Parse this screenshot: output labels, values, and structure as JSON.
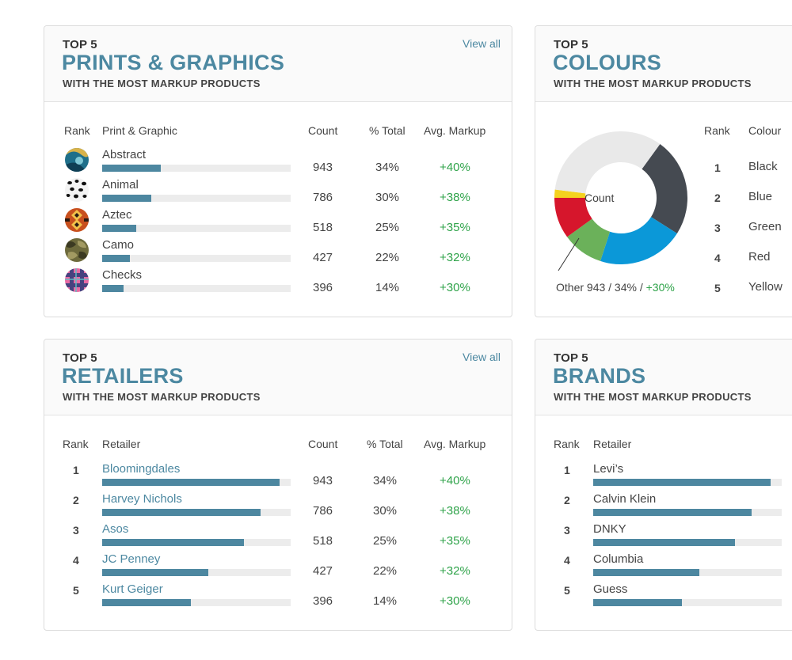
{
  "prints": {
    "top": "TOP 5",
    "title": "PRINTS & GRAPHICS",
    "subtitle": "WITH THE MOST MARKUP PRODUCTS",
    "view_all": "View all",
    "columns": {
      "rank": "Rank",
      "item": "Print & Graphic",
      "count": "Count",
      "total": "% Total",
      "markup": "Avg. Markup"
    },
    "rows": [
      {
        "name": "Abstract",
        "count": "943",
        "total": "34%",
        "markup": "+40%",
        "bar": 0.31,
        "swatch": "abstract-swatch-icon"
      },
      {
        "name": "Animal",
        "count": "786",
        "total": "30%",
        "markup": "+38%",
        "bar": 0.26,
        "swatch": "animal-swatch-icon"
      },
      {
        "name": "Aztec",
        "count": "518",
        "total": "25%",
        "markup": "+35%",
        "bar": 0.18,
        "swatch": "aztec-swatch-icon"
      },
      {
        "name": "Camo",
        "count": "427",
        "total": "22%",
        "markup": "+32%",
        "bar": 0.147,
        "swatch": "camo-swatch-icon"
      },
      {
        "name": "Checks",
        "count": "396",
        "total": "14%",
        "markup": "+30%",
        "bar": 0.115,
        "swatch": "checks-swatch-icon"
      }
    ]
  },
  "colours": {
    "top": "TOP 5",
    "title": "COLOURS",
    "subtitle": "WITH THE MOST MARKUP PRODUCTS",
    "center_label": "Count",
    "other_label": "Other 943 / 34% / ",
    "other_markup": "+30%",
    "columns": {
      "rank": "Rank",
      "item": "Colour"
    },
    "rows": [
      {
        "rank": "1",
        "name": "Black"
      },
      {
        "rank": "2",
        "name": "Blue"
      },
      {
        "rank": "3",
        "name": "Green"
      },
      {
        "rank": "4",
        "name": "Red"
      },
      {
        "rank": "5",
        "name": "Yellow"
      }
    ],
    "segments": [
      {
        "name": "Black",
        "value": 24,
        "color": "#454a51"
      },
      {
        "name": "Blue",
        "value": 21,
        "color": "#0b98d8"
      },
      {
        "name": "Green",
        "value": 10,
        "color": "#6bb15a"
      },
      {
        "name": "Red",
        "value": 10,
        "color": "#d6162c"
      },
      {
        "name": "Yellow",
        "value": 2,
        "color": "#f4d21f"
      },
      {
        "name": "Other",
        "value": 33,
        "color": "#e9e9e9"
      }
    ]
  },
  "retailers": {
    "top": "TOP 5",
    "title": "RETAILERS",
    "subtitle": "WITH THE MOST MARKUP PRODUCTS",
    "view_all": "View all",
    "columns": {
      "rank": "Rank",
      "item": "Retailer",
      "count": "Count",
      "total": "% Total",
      "markup": "Avg. Markup"
    },
    "rows": [
      {
        "rank": "1",
        "name": "Bloomingdales",
        "count": "943",
        "total": "34%",
        "markup": "+40%",
        "bar": 0.94
      },
      {
        "rank": "2",
        "name": "Harvey Nichols",
        "count": "786",
        "total": "30%",
        "markup": "+38%",
        "bar": 0.84
      },
      {
        "rank": "3",
        "name": "Asos",
        "count": "518",
        "total": "25%",
        "markup": "+35%",
        "bar": 0.75
      },
      {
        "rank": "4",
        "name": "JC Penney",
        "count": "427",
        "total": "22%",
        "markup": "+32%",
        "bar": 0.565
      },
      {
        "rank": "5",
        "name": "Kurt Geiger",
        "count": "396",
        "total": "14%",
        "markup": "+30%",
        "bar": 0.47
      }
    ]
  },
  "brands": {
    "top": "TOP 5",
    "title": "BRANDS",
    "subtitle": "WITH THE MOST MARKUP PRODUCTS",
    "columns": {
      "rank": "Rank",
      "item": "Retailer"
    },
    "rows": [
      {
        "rank": "1",
        "name": "Levi’s",
        "bar": 0.94
      },
      {
        "rank": "2",
        "name": "Calvin Klein",
        "bar": 0.84
      },
      {
        "rank": "3",
        "name": "DNKY",
        "bar": 0.75
      },
      {
        "rank": "4",
        "name": "Columbia",
        "bar": 0.565
      },
      {
        "rank": "5",
        "name": "Guess",
        "bar": 0.47
      }
    ]
  }
}
